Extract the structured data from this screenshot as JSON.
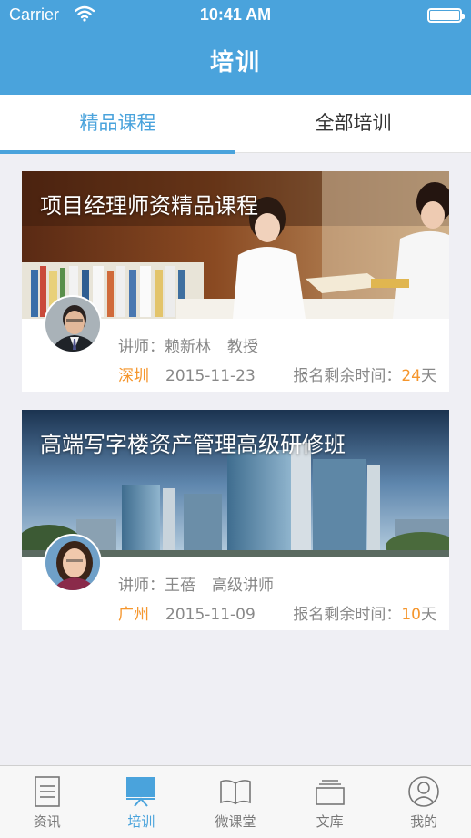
{
  "status_bar": {
    "carrier": "Carrier",
    "time": "10:41 AM"
  },
  "nav": {
    "title": "培训"
  },
  "tabs": [
    {
      "label": "精品课程",
      "active": true
    },
    {
      "label": "全部培训",
      "active": false
    }
  ],
  "courses": [
    {
      "title": "项目经理师资精品课程",
      "lecturer_label": "讲师：",
      "lecturer_name": "赖新林",
      "lecturer_title": "教授",
      "city": "深圳",
      "date": "2015-11-23",
      "remaining_label": "报名剩余时间：",
      "remaining_days": "24",
      "days_unit": "天"
    },
    {
      "title": "高端写字楼资产管理高级研修班",
      "lecturer_label": "讲师：",
      "lecturer_name": "王蓓",
      "lecturer_title": "高级讲师",
      "city": "广州",
      "date": "2015-11-09",
      "remaining_label": "报名剩余时间：",
      "remaining_days": "10",
      "days_unit": "天"
    }
  ],
  "tabbar": [
    {
      "label": "资讯",
      "icon": "document-icon",
      "active": false
    },
    {
      "label": "培训",
      "icon": "presentation-board-icon",
      "active": true
    },
    {
      "label": "微课堂",
      "icon": "open-book-icon",
      "active": false
    },
    {
      "label": "文库",
      "icon": "stacked-tray-icon",
      "active": false
    },
    {
      "label": "我的",
      "icon": "user-profile-icon",
      "active": false
    }
  ],
  "colors": {
    "primary": "#4aa3dc",
    "accent": "#f5962d",
    "text_gray": "#888888",
    "background": "#efeff4"
  }
}
